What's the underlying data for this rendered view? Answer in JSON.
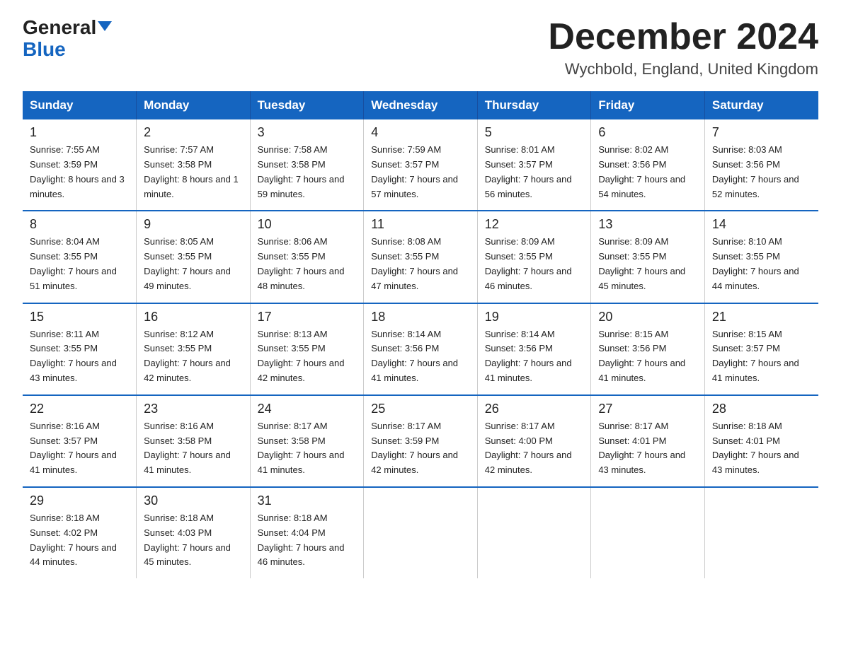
{
  "header": {
    "logo_line1": "General",
    "logo_line2": "Blue",
    "month_title": "December 2024",
    "location": "Wychbold, England, United Kingdom"
  },
  "days_of_week": [
    "Sunday",
    "Monday",
    "Tuesday",
    "Wednesday",
    "Thursday",
    "Friday",
    "Saturday"
  ],
  "weeks": [
    [
      {
        "num": "1",
        "sunrise": "7:55 AM",
        "sunset": "3:59 PM",
        "daylight": "8 hours and 3 minutes."
      },
      {
        "num": "2",
        "sunrise": "7:57 AM",
        "sunset": "3:58 PM",
        "daylight": "8 hours and 1 minute."
      },
      {
        "num": "3",
        "sunrise": "7:58 AM",
        "sunset": "3:58 PM",
        "daylight": "7 hours and 59 minutes."
      },
      {
        "num": "4",
        "sunrise": "7:59 AM",
        "sunset": "3:57 PM",
        "daylight": "7 hours and 57 minutes."
      },
      {
        "num": "5",
        "sunrise": "8:01 AM",
        "sunset": "3:57 PM",
        "daylight": "7 hours and 56 minutes."
      },
      {
        "num": "6",
        "sunrise": "8:02 AM",
        "sunset": "3:56 PM",
        "daylight": "7 hours and 54 minutes."
      },
      {
        "num": "7",
        "sunrise": "8:03 AM",
        "sunset": "3:56 PM",
        "daylight": "7 hours and 52 minutes."
      }
    ],
    [
      {
        "num": "8",
        "sunrise": "8:04 AM",
        "sunset": "3:55 PM",
        "daylight": "7 hours and 51 minutes."
      },
      {
        "num": "9",
        "sunrise": "8:05 AM",
        "sunset": "3:55 PM",
        "daylight": "7 hours and 49 minutes."
      },
      {
        "num": "10",
        "sunrise": "8:06 AM",
        "sunset": "3:55 PM",
        "daylight": "7 hours and 48 minutes."
      },
      {
        "num": "11",
        "sunrise": "8:08 AM",
        "sunset": "3:55 PM",
        "daylight": "7 hours and 47 minutes."
      },
      {
        "num": "12",
        "sunrise": "8:09 AM",
        "sunset": "3:55 PM",
        "daylight": "7 hours and 46 minutes."
      },
      {
        "num": "13",
        "sunrise": "8:09 AM",
        "sunset": "3:55 PM",
        "daylight": "7 hours and 45 minutes."
      },
      {
        "num": "14",
        "sunrise": "8:10 AM",
        "sunset": "3:55 PM",
        "daylight": "7 hours and 44 minutes."
      }
    ],
    [
      {
        "num": "15",
        "sunrise": "8:11 AM",
        "sunset": "3:55 PM",
        "daylight": "7 hours and 43 minutes."
      },
      {
        "num": "16",
        "sunrise": "8:12 AM",
        "sunset": "3:55 PM",
        "daylight": "7 hours and 42 minutes."
      },
      {
        "num": "17",
        "sunrise": "8:13 AM",
        "sunset": "3:55 PM",
        "daylight": "7 hours and 42 minutes."
      },
      {
        "num": "18",
        "sunrise": "8:14 AM",
        "sunset": "3:56 PM",
        "daylight": "7 hours and 41 minutes."
      },
      {
        "num": "19",
        "sunrise": "8:14 AM",
        "sunset": "3:56 PM",
        "daylight": "7 hours and 41 minutes."
      },
      {
        "num": "20",
        "sunrise": "8:15 AM",
        "sunset": "3:56 PM",
        "daylight": "7 hours and 41 minutes."
      },
      {
        "num": "21",
        "sunrise": "8:15 AM",
        "sunset": "3:57 PM",
        "daylight": "7 hours and 41 minutes."
      }
    ],
    [
      {
        "num": "22",
        "sunrise": "8:16 AM",
        "sunset": "3:57 PM",
        "daylight": "7 hours and 41 minutes."
      },
      {
        "num": "23",
        "sunrise": "8:16 AM",
        "sunset": "3:58 PM",
        "daylight": "7 hours and 41 minutes."
      },
      {
        "num": "24",
        "sunrise": "8:17 AM",
        "sunset": "3:58 PM",
        "daylight": "7 hours and 41 minutes."
      },
      {
        "num": "25",
        "sunrise": "8:17 AM",
        "sunset": "3:59 PM",
        "daylight": "7 hours and 42 minutes."
      },
      {
        "num": "26",
        "sunrise": "8:17 AM",
        "sunset": "4:00 PM",
        "daylight": "7 hours and 42 minutes."
      },
      {
        "num": "27",
        "sunrise": "8:17 AM",
        "sunset": "4:01 PM",
        "daylight": "7 hours and 43 minutes."
      },
      {
        "num": "28",
        "sunrise": "8:18 AM",
        "sunset": "4:01 PM",
        "daylight": "7 hours and 43 minutes."
      }
    ],
    [
      {
        "num": "29",
        "sunrise": "8:18 AM",
        "sunset": "4:02 PM",
        "daylight": "7 hours and 44 minutes."
      },
      {
        "num": "30",
        "sunrise": "8:18 AM",
        "sunset": "4:03 PM",
        "daylight": "7 hours and 45 minutes."
      },
      {
        "num": "31",
        "sunrise": "8:18 AM",
        "sunset": "4:04 PM",
        "daylight": "7 hours and 46 minutes."
      },
      null,
      null,
      null,
      null
    ]
  ]
}
